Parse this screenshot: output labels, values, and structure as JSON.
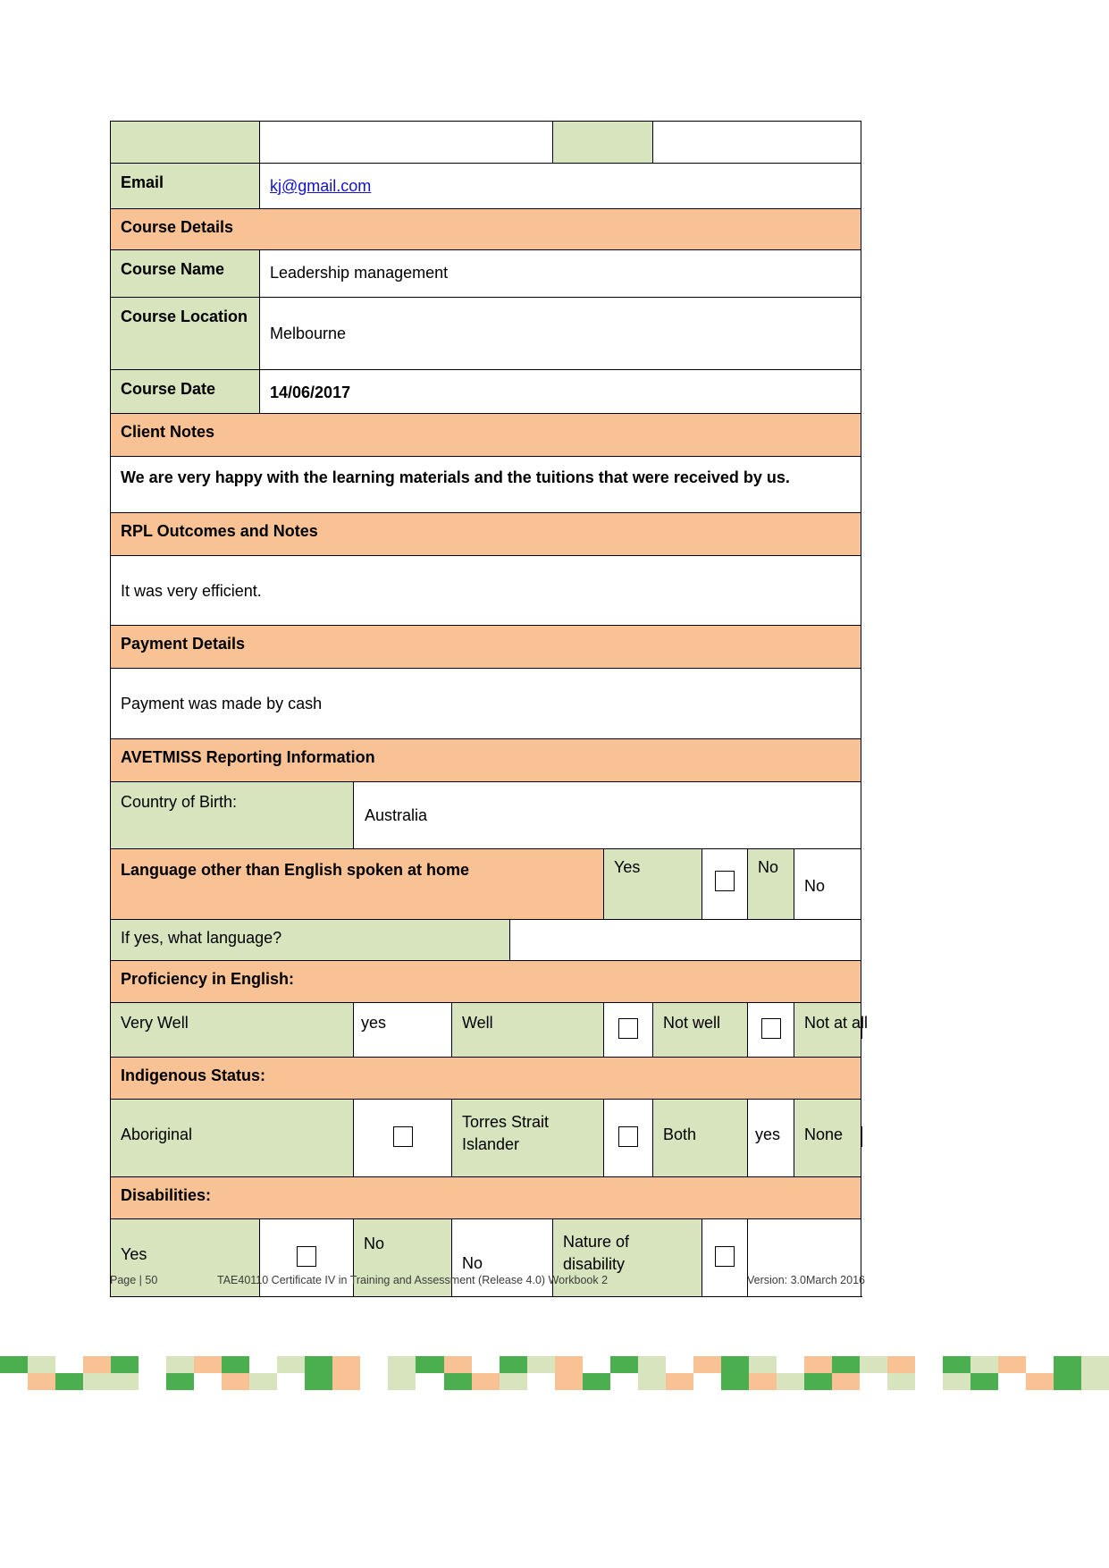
{
  "colors": {
    "green": "#d7e4bd",
    "orange": "#f8c295",
    "white": "#ffffff",
    "link": "#1111cc",
    "border": "#000000",
    "strip_green_dark": "#4caf4f",
    "strip_green_light": "#d7e4bd",
    "strip_orange": "#f8c295",
    "strip_white": "#ffffff"
  },
  "form": {
    "top_row": {
      "cell1": "",
      "cell2": "",
      "cell3": "",
      "cell4": ""
    },
    "email": {
      "label": "Email",
      "value": "kj@gmail.com"
    },
    "course_details_header": "Course Details",
    "course_name": {
      "label": "Course Name",
      "value": "Leadership management"
    },
    "course_location": {
      "label": "Course Location",
      "value": "Melbourne"
    },
    "course_date": {
      "label": "Course Date",
      "value": "14/06/2017"
    },
    "client_notes_header": "Client Notes",
    "client_notes_text": "We are very happy with the learning materials and the tuitions that were received by us.",
    "rpl_header": "RPL Outcomes and Notes",
    "rpl_text": "It was very efficient.",
    "payment_header": "Payment Details",
    "payment_text": "Payment was made by cash",
    "avetmiss_header": "AVETMISS Reporting Information",
    "country_of_birth": {
      "label": "Country of Birth:",
      "value": "Australia"
    },
    "language_other": {
      "label": "Language other than English spoken at home",
      "yes_label": "Yes",
      "yes_checkbox": "unchecked",
      "no_label": "No",
      "answer": "No"
    },
    "if_yes_language": {
      "label": "If yes, what language?",
      "value": ""
    },
    "proficiency_header": "Proficiency in English:",
    "proficiency": {
      "very_well_label": "Very Well",
      "very_well_answer": "yes",
      "well_label": "Well",
      "well_checkbox": "unchecked",
      "not_well_label": "Not well",
      "not_well_checkbox": "unchecked",
      "not_at_all_label": "Not at all",
      "not_at_all_checkbox": "unchecked"
    },
    "indigenous_header": "Indigenous Status:",
    "indigenous": {
      "aboriginal_label": "Aboriginal",
      "aboriginal_checkbox": "unchecked",
      "tsi_label": "Torres Strait Islander",
      "tsi_checkbox": "unchecked",
      "both_label": "Both",
      "both_answer": "yes",
      "none_label": "None",
      "none_checkbox": "unchecked"
    },
    "disabilities_header": "Disabilities:",
    "disabilities": {
      "yes_label": "Yes",
      "yes_checkbox": "unchecked",
      "no_label": "No",
      "no_answer": "No",
      "nature_label": "Nature of disability",
      "nature_checkbox": "unchecked",
      "nature_value": ""
    }
  },
  "footer": {
    "page": "Page | 50",
    "doc_title": "TAE40110 Certificate IV in Training and Assessment (Release 4.0) Workbook 2",
    "version": "Version: 3.0March 2016"
  }
}
